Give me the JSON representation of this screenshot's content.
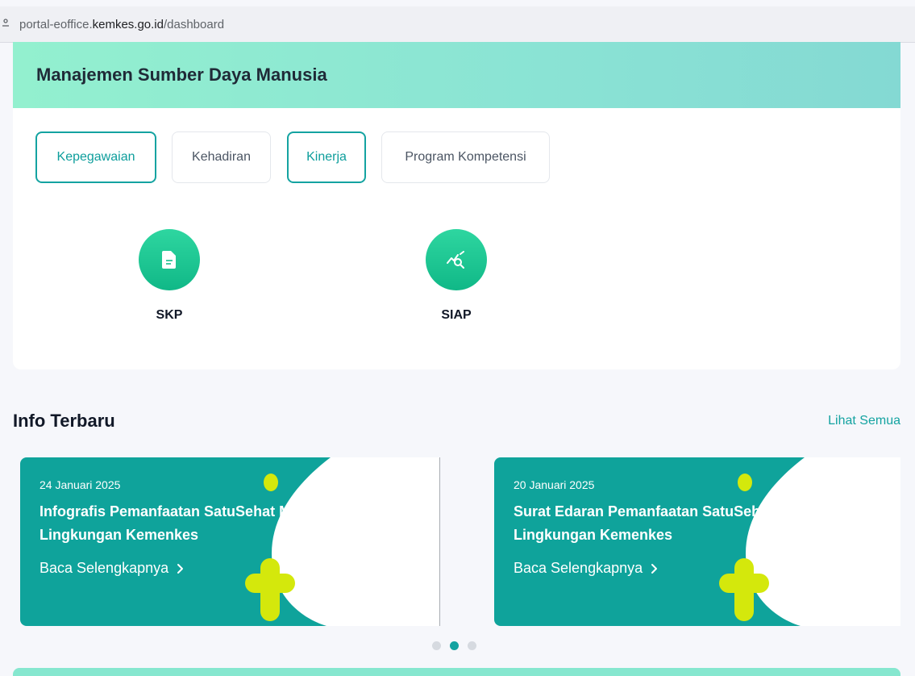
{
  "browser": {
    "url_prefix": "portal-eoffice.",
    "url_domain": "kemkes.go.id",
    "url_path": "/dashboard"
  },
  "section": {
    "title": "Manajemen Sumber Daya Manusia",
    "tabs": [
      {
        "label": "Kepegawaian",
        "active": true
      },
      {
        "label": "Kehadiran",
        "active": false
      },
      {
        "label": "Kinerja",
        "active": true
      },
      {
        "label": "Program Kompetensi",
        "active": false
      }
    ],
    "apps": [
      {
        "label": "SKP",
        "icon": "document-icon"
      },
      {
        "label": "SIAP",
        "icon": "chart-search-icon"
      }
    ]
  },
  "info": {
    "title": "Info Terbaru",
    "see_all": "Lihat Semua",
    "cards": [
      {
        "date": "24 Januari 2025",
        "title": "Infografis Pemanfaatan SatuSehat Mobile di Lingkungan Kemenkes",
        "more": "Baca Selengkapnya"
      },
      {
        "date": "20 Januari 2025",
        "title": "Surat Edaran Pemanfaatan SatuSehat Mobile di Lingkungan Kemenkes",
        "more": "Baca Selengkapnya"
      }
    ],
    "active_page": 2,
    "page_count": 3
  },
  "colors": {
    "accent": "#14a3a1",
    "card_bg": "#0fa39b",
    "deco_yellow": "#d4e80c",
    "header_gradient_start": "#93f0cf",
    "header_gradient_end": "#84d9d3"
  }
}
